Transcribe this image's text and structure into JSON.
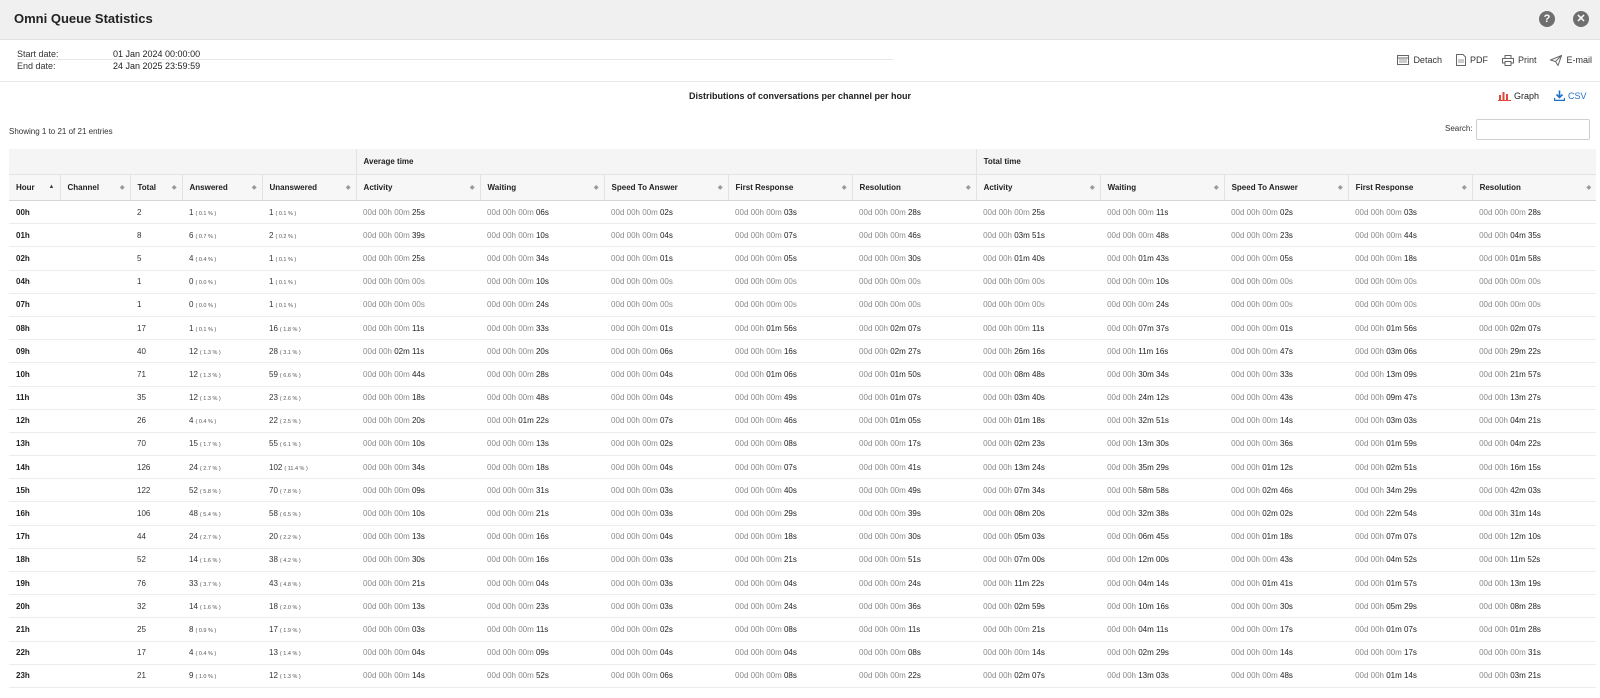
{
  "window": {
    "title": "Omni Queue Statistics",
    "help_icon": "question-circle-icon",
    "close_icon": "close-circle-icon"
  },
  "dates": {
    "start_label": "Start date:",
    "start_value": "01 Jan 2024 00:00:00",
    "end_label": "End date:",
    "end_value": "24 Jan 2025 23:59:59"
  },
  "actions": {
    "detach": "Detach",
    "pdf": "PDF",
    "print": "Print",
    "email": "E-mail"
  },
  "report": {
    "title": "Distributions of conversations per channel per hour",
    "graph_label": "Graph",
    "csv_label": "CSV",
    "csv_color": "#1f6fc7",
    "graph_color": "#e0463c"
  },
  "table_info": {
    "showing": "Showing 1 to 21 of 21 entries",
    "search_label": "Search:",
    "search_value": ""
  },
  "groups": {
    "average": "Average time",
    "total": "Total time"
  },
  "columns": [
    "Hour",
    "Channel",
    "Total",
    "Answered",
    "Unanswered",
    "Activity",
    "Waiting",
    "Speed To Answer",
    "First Response",
    "Resolution",
    "Activity",
    "Waiting",
    "Speed To Answer",
    "First Response",
    "Resolution"
  ],
  "rows": [
    {
      "hour": "00h",
      "channel": "",
      "total": "2",
      "answered": "1",
      "answered_pct": "( 0.1 % )",
      "unanswered": "1",
      "unanswered_pct": "( 0.1 % )",
      "avg": [
        "00d 00h 00m 25s",
        "00d 00h 00m 06s",
        "00d 00h 00m 02s",
        "00d 00h 00m 03s",
        "00d 00h 00m 28s"
      ],
      "tot": [
        "00d 00h 00m 25s",
        "00d 00h 00m 11s",
        "00d 00h 00m 02s",
        "00d 00h 00m 03s",
        "00d 00h 00m 28s"
      ]
    },
    {
      "hour": "01h",
      "channel": "",
      "total": "8",
      "answered": "6",
      "answered_pct": "( 0.7 % )",
      "unanswered": "2",
      "unanswered_pct": "( 0.2 % )",
      "avg": [
        "00d 00h 00m 39s",
        "00d 00h 00m 10s",
        "00d 00h 00m 04s",
        "00d 00h 00m 07s",
        "00d 00h 00m 46s"
      ],
      "tot": [
        "00d 00h 03m 51s",
        "00d 00h 00m 48s",
        "00d 00h 00m 23s",
        "00d 00h 00m 44s",
        "00d 00h 04m 35s"
      ]
    },
    {
      "hour": "02h",
      "channel": "",
      "total": "5",
      "answered": "4",
      "answered_pct": "( 0.4 % )",
      "unanswered": "1",
      "unanswered_pct": "( 0.1 % )",
      "avg": [
        "00d 00h 00m 25s",
        "00d 00h 00m 34s",
        "00d 00h 00m 01s",
        "00d 00h 00m 05s",
        "00d 00h 00m 30s"
      ],
      "tot": [
        "00d 00h 01m 40s",
        "00d 00h 01m 43s",
        "00d 00h 00m 05s",
        "00d 00h 00m 18s",
        "00d 00h 01m 58s"
      ]
    },
    {
      "hour": "04h",
      "channel": "",
      "total": "1",
      "answered": "0",
      "answered_pct": "( 0.0 % )",
      "unanswered": "1",
      "unanswered_pct": "( 0.1 % )",
      "avg": [
        "00d 00h 00m 00s",
        "00d 00h 00m 10s",
        "00d 00h 00m 00s",
        "00d 00h 00m 00s",
        "00d 00h 00m 00s"
      ],
      "tot": [
        "00d 00h 00m 00s",
        "00d 00h 00m 10s",
        "00d 00h 00m 00s",
        "00d 00h 00m 00s",
        "00d 00h 00m 00s"
      ]
    },
    {
      "hour": "07h",
      "channel": "",
      "total": "1",
      "answered": "0",
      "answered_pct": "( 0.0 % )",
      "unanswered": "1",
      "unanswered_pct": "( 0.1 % )",
      "avg": [
        "00d 00h 00m 00s",
        "00d 00h 00m 24s",
        "00d 00h 00m 00s",
        "00d 00h 00m 00s",
        "00d 00h 00m 00s"
      ],
      "tot": [
        "00d 00h 00m 00s",
        "00d 00h 00m 24s",
        "00d 00h 00m 00s",
        "00d 00h 00m 00s",
        "00d 00h 00m 00s"
      ]
    },
    {
      "hour": "08h",
      "channel": "",
      "total": "17",
      "answered": "1",
      "answered_pct": "( 0.1 % )",
      "unanswered": "16",
      "unanswered_pct": "( 1.8 % )",
      "avg": [
        "00d 00h 00m 11s",
        "00d 00h 00m 33s",
        "00d 00h 00m 01s",
        "00d 00h 01m 56s",
        "00d 00h 02m 07s"
      ],
      "tot": [
        "00d 00h 00m 11s",
        "00d 00h 07m 37s",
        "00d 00h 00m 01s",
        "00d 00h 01m 56s",
        "00d 00h 02m 07s"
      ]
    },
    {
      "hour": "09h",
      "channel": "",
      "total": "40",
      "answered": "12",
      "answered_pct": "( 1.3 % )",
      "unanswered": "28",
      "unanswered_pct": "( 3.1 % )",
      "avg": [
        "00d 00h 02m 11s",
        "00d 00h 00m 20s",
        "00d 00h 00m 06s",
        "00d 00h 00m 16s",
        "00d 00h 02m 27s"
      ],
      "tot": [
        "00d 00h 26m 16s",
        "00d 00h 11m 16s",
        "00d 00h 00m 47s",
        "00d 00h 03m 06s",
        "00d 00h 29m 22s"
      ]
    },
    {
      "hour": "10h",
      "channel": "",
      "total": "71",
      "answered": "12",
      "answered_pct": "( 1.3 % )",
      "unanswered": "59",
      "unanswered_pct": "( 6.6 % )",
      "avg": [
        "00d 00h 00m 44s",
        "00d 00h 00m 28s",
        "00d 00h 00m 04s",
        "00d 00h 01m 06s",
        "00d 00h 01m 50s"
      ],
      "tot": [
        "00d 00h 08m 48s",
        "00d 00h 30m 34s",
        "00d 00h 00m 33s",
        "00d 00h 13m 09s",
        "00d 00h 21m 57s"
      ]
    },
    {
      "hour": "11h",
      "channel": "",
      "total": "35",
      "answered": "12",
      "answered_pct": "( 1.3 % )",
      "unanswered": "23",
      "unanswered_pct": "( 2.6 % )",
      "avg": [
        "00d 00h 00m 18s",
        "00d 00h 00m 48s",
        "00d 00h 00m 04s",
        "00d 00h 00m 49s",
        "00d 00h 01m 07s"
      ],
      "tot": [
        "00d 00h 03m 40s",
        "00d 00h 24m 12s",
        "00d 00h 00m 43s",
        "00d 00h 09m 47s",
        "00d 00h 13m 27s"
      ]
    },
    {
      "hour": "12h",
      "channel": "",
      "total": "26",
      "answered": "4",
      "answered_pct": "( 0.4 % )",
      "unanswered": "22",
      "unanswered_pct": "( 2.5 % )",
      "avg": [
        "00d 00h 00m 20s",
        "00d 00h 01m 22s",
        "00d 00h 00m 07s",
        "00d 00h 00m 46s",
        "00d 00h 01m 05s"
      ],
      "tot": [
        "00d 00h 01m 18s",
        "00d 00h 32m 51s",
        "00d 00h 00m 14s",
        "00d 00h 03m 03s",
        "00d 00h 04m 21s"
      ]
    },
    {
      "hour": "13h",
      "channel": "",
      "total": "70",
      "answered": "15",
      "answered_pct": "( 1.7 % )",
      "unanswered": "55",
      "unanswered_pct": "( 6.1 % )",
      "avg": [
        "00d 00h 00m 10s",
        "00d 00h 00m 13s",
        "00d 00h 00m 02s",
        "00d 00h 00m 08s",
        "00d 00h 00m 17s"
      ],
      "tot": [
        "00d 00h 02m 23s",
        "00d 00h 13m 30s",
        "00d 00h 00m 36s",
        "00d 00h 01m 59s",
        "00d 00h 04m 22s"
      ]
    },
    {
      "hour": "14h",
      "channel": "",
      "total": "126",
      "answered": "24",
      "answered_pct": "( 2.7 % )",
      "unanswered": "102",
      "unanswered_pct": "( 11.4 % )",
      "avg": [
        "00d 00h 00m 34s",
        "00d 00h 00m 18s",
        "00d 00h 00m 04s",
        "00d 00h 00m 07s",
        "00d 00h 00m 41s"
      ],
      "tot": [
        "00d 00h 13m 24s",
        "00d 00h 35m 29s",
        "00d 00h 01m 12s",
        "00d 00h 02m 51s",
        "00d 00h 16m 15s"
      ]
    },
    {
      "hour": "15h",
      "channel": "",
      "total": "122",
      "answered": "52",
      "answered_pct": "( 5.8 % )",
      "unanswered": "70",
      "unanswered_pct": "( 7.8 % )",
      "avg": [
        "00d 00h 00m 09s",
        "00d 00h 00m 31s",
        "00d 00h 00m 03s",
        "00d 00h 00m 40s",
        "00d 00h 00m 49s"
      ],
      "tot": [
        "00d 00h 07m 34s",
        "00d 00h 58m 58s",
        "00d 00h 02m 46s",
        "00d 00h 34m 29s",
        "00d 00h 42m 03s"
      ]
    },
    {
      "hour": "16h",
      "channel": "",
      "total": "106",
      "answered": "48",
      "answered_pct": "( 5.4 % )",
      "unanswered": "58",
      "unanswered_pct": "( 6.5 % )",
      "avg": [
        "00d 00h 00m 10s",
        "00d 00h 00m 21s",
        "00d 00h 00m 03s",
        "00d 00h 00m 29s",
        "00d 00h 00m 39s"
      ],
      "tot": [
        "00d 00h 08m 20s",
        "00d 00h 32m 38s",
        "00d 00h 02m 02s",
        "00d 00h 22m 54s",
        "00d 00h 31m 14s"
      ]
    },
    {
      "hour": "17h",
      "channel": "",
      "total": "44",
      "answered": "24",
      "answered_pct": "( 2.7 % )",
      "unanswered": "20",
      "unanswered_pct": "( 2.2 % )",
      "avg": [
        "00d 00h 00m 13s",
        "00d 00h 00m 16s",
        "00d 00h 00m 04s",
        "00d 00h 00m 18s",
        "00d 00h 00m 30s"
      ],
      "tot": [
        "00d 00h 05m 03s",
        "00d 00h 06m 45s",
        "00d 00h 01m 18s",
        "00d 00h 07m 07s",
        "00d 00h 12m 10s"
      ]
    },
    {
      "hour": "18h",
      "channel": "",
      "total": "52",
      "answered": "14",
      "answered_pct": "( 1.6 % )",
      "unanswered": "38",
      "unanswered_pct": "( 4.2 % )",
      "avg": [
        "00d 00h 00m 30s",
        "00d 00h 00m 16s",
        "00d 00h 00m 03s",
        "00d 00h 00m 21s",
        "00d 00h 00m 51s"
      ],
      "tot": [
        "00d 00h 07m 00s",
        "00d 00h 12m 00s",
        "00d 00h 00m 43s",
        "00d 00h 04m 52s",
        "00d 00h 11m 52s"
      ]
    },
    {
      "hour": "19h",
      "channel": "",
      "total": "76",
      "answered": "33",
      "answered_pct": "( 3.7 % )",
      "unanswered": "43",
      "unanswered_pct": "( 4.8 % )",
      "avg": [
        "00d 00h 00m 21s",
        "00d 00h 00m 04s",
        "00d 00h 00m 03s",
        "00d 00h 00m 04s",
        "00d 00h 00m 24s"
      ],
      "tot": [
        "00d 00h 11m 22s",
        "00d 00h 04m 14s",
        "00d 00h 01m 41s",
        "00d 00h 01m 57s",
        "00d 00h 13m 19s"
      ]
    },
    {
      "hour": "20h",
      "channel": "",
      "total": "32",
      "answered": "14",
      "answered_pct": "( 1.6 % )",
      "unanswered": "18",
      "unanswered_pct": "( 2.0 % )",
      "avg": [
        "00d 00h 00m 13s",
        "00d 00h 00m 23s",
        "00d 00h 00m 03s",
        "00d 00h 00m 24s",
        "00d 00h 00m 36s"
      ],
      "tot": [
        "00d 00h 02m 59s",
        "00d 00h 10m 16s",
        "00d 00h 00m 30s",
        "00d 00h 05m 29s",
        "00d 00h 08m 28s"
      ]
    },
    {
      "hour": "21h",
      "channel": "",
      "total": "25",
      "answered": "8",
      "answered_pct": "( 0.9 % )",
      "unanswered": "17",
      "unanswered_pct": "( 1.9 % )",
      "avg": [
        "00d 00h 00m 03s",
        "00d 00h 00m 11s",
        "00d 00h 00m 02s",
        "00d 00h 00m 08s",
        "00d 00h 00m 11s"
      ],
      "tot": [
        "00d 00h 00m 21s",
        "00d 00h 04m 11s",
        "00d 00h 00m 17s",
        "00d 00h 01m 07s",
        "00d 00h 01m 28s"
      ]
    },
    {
      "hour": "22h",
      "channel": "",
      "total": "17",
      "answered": "4",
      "answered_pct": "( 0.4 % )",
      "unanswered": "13",
      "unanswered_pct": "( 1.4 % )",
      "avg": [
        "00d 00h 00m 04s",
        "00d 00h 00m 09s",
        "00d 00h 00m 04s",
        "00d 00h 00m 04s",
        "00d 00h 00m 08s"
      ],
      "tot": [
        "00d 00h 00m 14s",
        "00d 00h 02m 29s",
        "00d 00h 00m 14s",
        "00d 00h 00m 17s",
        "00d 00h 00m 31s"
      ]
    },
    {
      "hour": "23h",
      "channel": "",
      "total": "21",
      "answered": "9",
      "answered_pct": "( 1.0 % )",
      "unanswered": "12",
      "unanswered_pct": "( 1.3 % )",
      "avg": [
        "00d 00h 00m 14s",
        "00d 00h 00m 52s",
        "00d 00h 00m 06s",
        "00d 00h 00m 08s",
        "00d 00h 00m 22s"
      ],
      "tot": [
        "00d 00h 02m 07s",
        "00d 00h 13m 03s",
        "00d 00h 00m 48s",
        "00d 00h 01m 14s",
        "00d 00h 03m 21s"
      ]
    }
  ]
}
